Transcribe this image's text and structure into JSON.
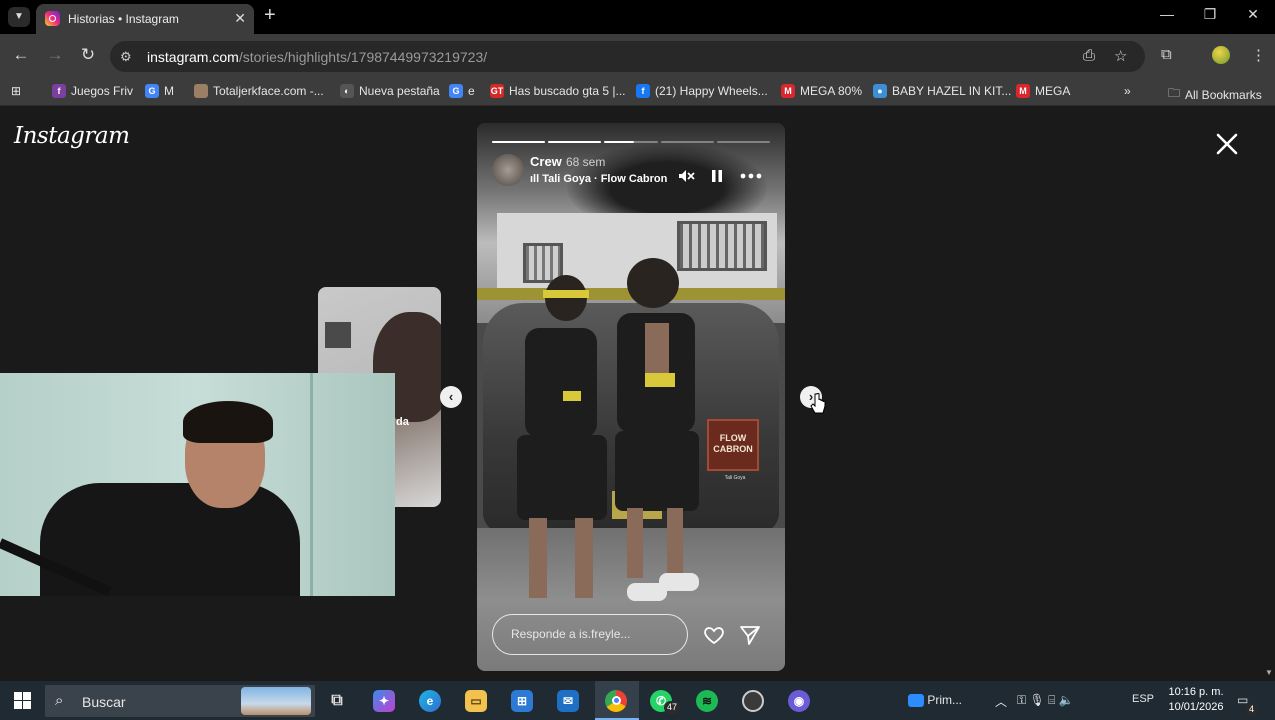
{
  "browser": {
    "tab": {
      "title": "Historias • Instagram"
    },
    "url": {
      "host": "instagram.com",
      "path": "/stories/highlights/17987449973219723/"
    },
    "bookmarks": [
      {
        "label": "Juegos Friv",
        "icon_color": "#7b3fa0",
        "icon_char": "f"
      },
      {
        "label": "M",
        "icon_color": "#4285f4",
        "icon_char": "G"
      },
      {
        "label": "Totaljerkface.com -...",
        "icon_color": "#9a7f64",
        "icon_char": ""
      },
      {
        "label": "Nueva pestaña",
        "icon_color": "#555555",
        "icon_char": "◐"
      },
      {
        "label": "e",
        "icon_color": "#4285f4",
        "icon_char": "G"
      },
      {
        "label": "Has buscado gta 5 |...",
        "icon_color": "#d12a2a",
        "icon_char": "GT"
      },
      {
        "label": "(21) Happy Wheels...",
        "icon_color": "#1877f2",
        "icon_char": "f"
      },
      {
        "label": "MEGA 80%",
        "icon_color": "#d9272e",
        "icon_char": "M"
      },
      {
        "label": "BABY HAZEL IN KIT...",
        "icon_color": "#3c8fd6",
        "icon_char": "●"
      },
      {
        "label": "MEGA",
        "icon_color": "#d9272e",
        "icon_char": "M"
      }
    ],
    "all_bookmarks_label": "All Bookmarks"
  },
  "instagram": {
    "logo": "Instagram",
    "prev_story_tag": "da",
    "story": {
      "username": "Crew",
      "time": "68 sem",
      "music": "Tali Goya · Flow Cabron",
      "reply_placeholder": "Responde a is.freyle...",
      "sticker_title": "FLOW CABRON",
      "sticker_sub": "Tali Goya",
      "segments": [
        1.0,
        1.0,
        0.55,
        0.0,
        0.0
      ]
    }
  },
  "taskbar": {
    "search_placeholder": "Buscar",
    "whatsapp_badge": "47",
    "zoom_label": "Prim...",
    "language": "ESP",
    "time": "10:16 p. m.",
    "date": "10/01/2026",
    "notifications": "4"
  },
  "colors": {
    "accent": "#7ab4f0",
    "instagram_bg": "#1a1a1a"
  }
}
